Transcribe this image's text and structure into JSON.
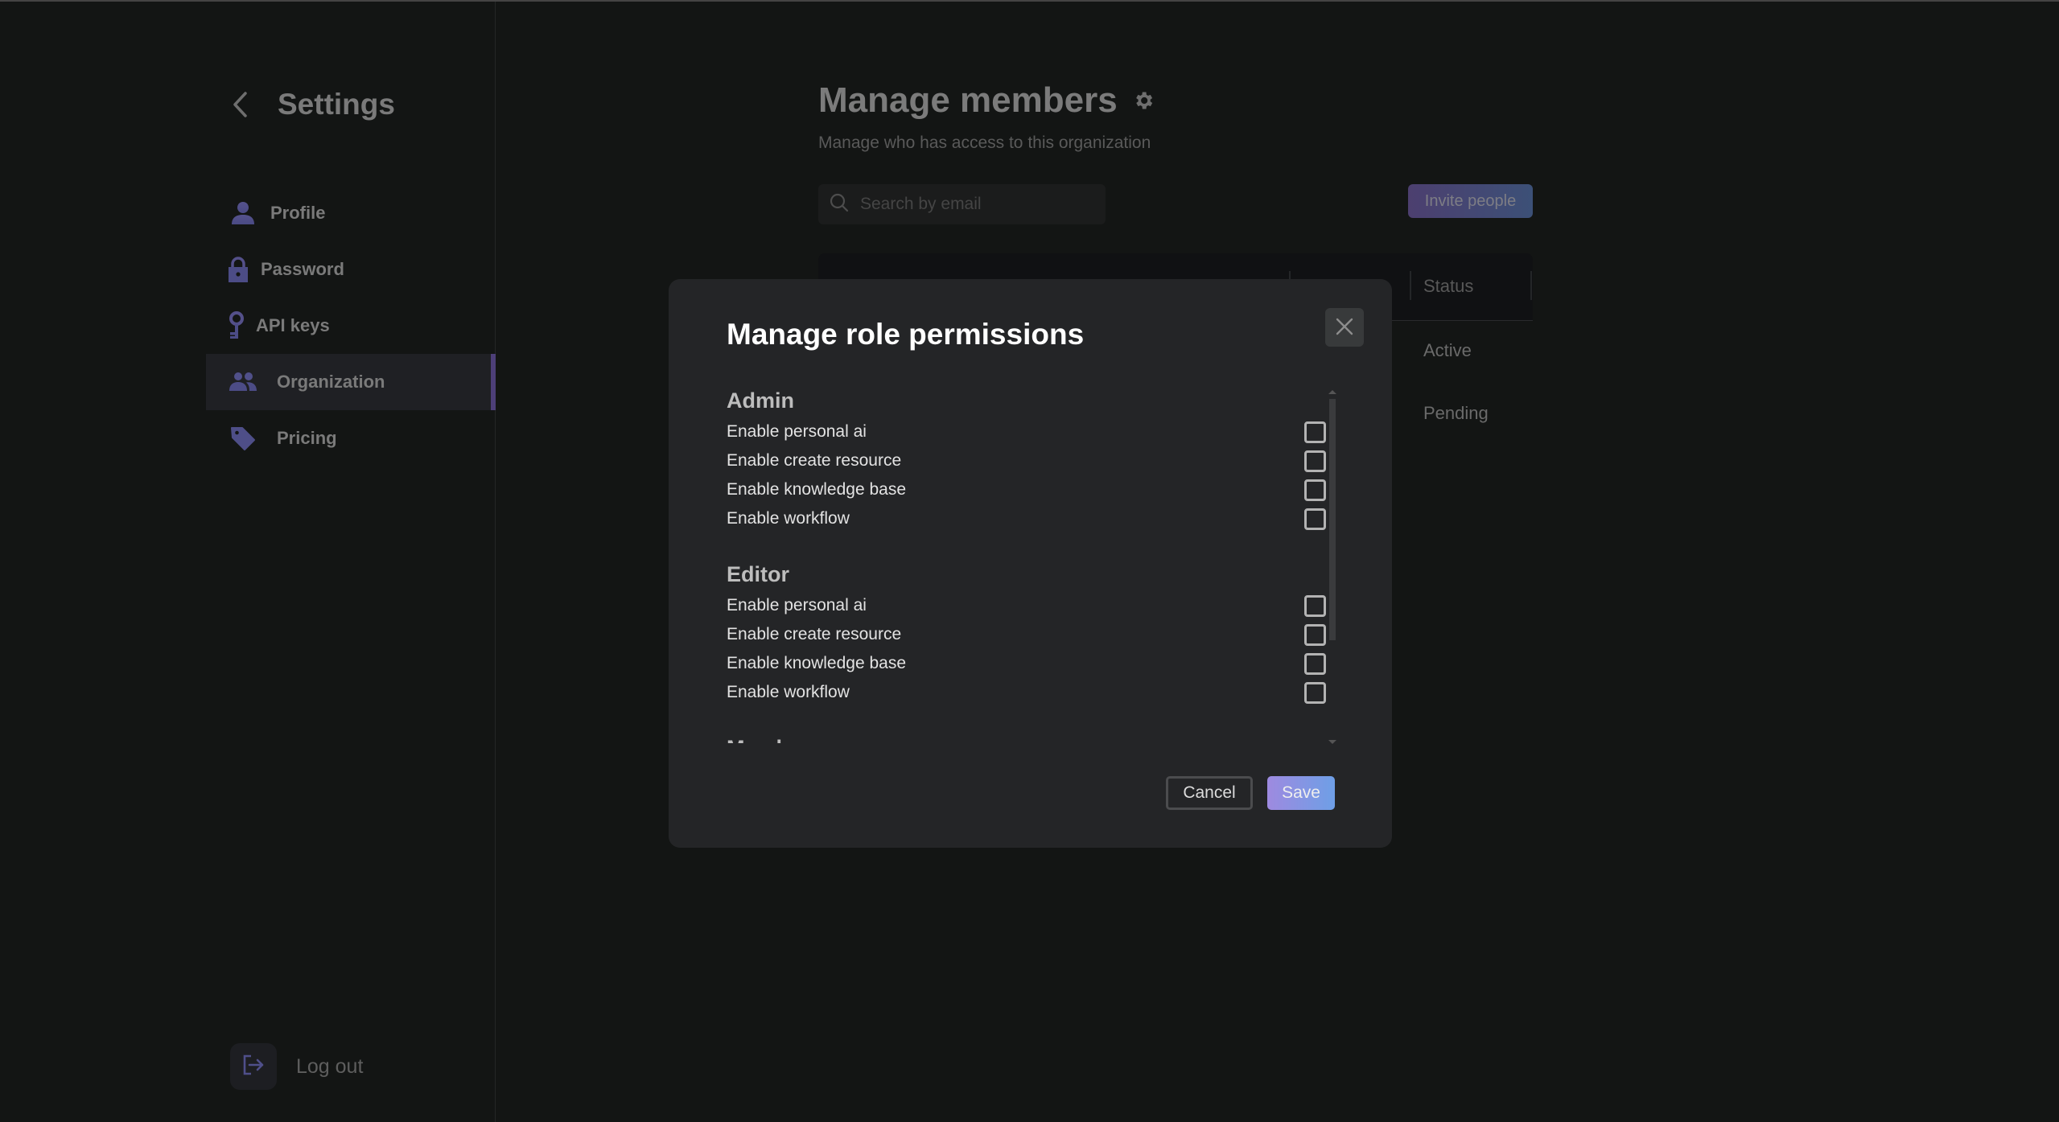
{
  "sidebar": {
    "title": "Settings",
    "back_icon": "chevron-left-icon",
    "items": [
      {
        "label": "Profile",
        "icon": "user-icon",
        "active": false
      },
      {
        "label": "Password",
        "icon": "lock-icon",
        "active": false
      },
      {
        "label": "API keys",
        "icon": "key-icon",
        "active": false
      },
      {
        "label": "Organization",
        "icon": "people-icon",
        "active": true
      },
      {
        "label": "Pricing",
        "icon": "tag-icon",
        "active": false
      }
    ],
    "logout_label": "Log out"
  },
  "main": {
    "title": "Manage members",
    "subtitle": "Manage who has access to this organization",
    "search": {
      "placeholder": "Search by email",
      "value": ""
    },
    "invite_label": "Invite people",
    "table": {
      "columns": [
        "Status"
      ],
      "rows": [
        {
          "status": "Active"
        },
        {
          "status": "Pending"
        }
      ]
    }
  },
  "modal": {
    "title": "Manage role permissions",
    "roles": [
      {
        "name": "Admin",
        "permissions": [
          {
            "label": "Enable personal ai",
            "checked": false
          },
          {
            "label": "Enable create resource",
            "checked": false
          },
          {
            "label": "Enable knowledge base",
            "checked": false
          },
          {
            "label": "Enable workflow",
            "checked": false
          }
        ]
      },
      {
        "name": "Editor",
        "permissions": [
          {
            "label": "Enable personal ai",
            "checked": false
          },
          {
            "label": "Enable create resource",
            "checked": false
          },
          {
            "label": "Enable knowledge base",
            "checked": false
          },
          {
            "label": "Enable workflow",
            "checked": false
          }
        ]
      },
      {
        "name": "Member",
        "permissions": []
      }
    ],
    "cancel_label": "Cancel",
    "save_label": "Save"
  },
  "colors": {
    "background": "#131514",
    "modal_bg": "#242527",
    "accent_purple": "#9e8ae0",
    "accent_blue": "#6e9fe6",
    "icon_purple": "#4f4f8a"
  }
}
